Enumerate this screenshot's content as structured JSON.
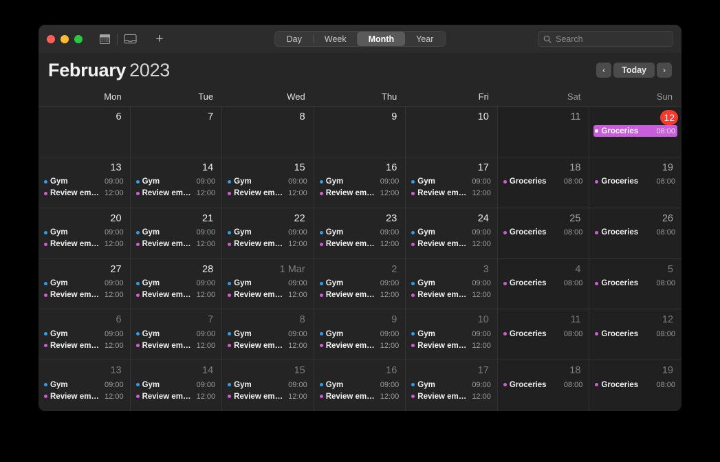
{
  "window": {
    "traffic_lights": [
      {
        "name": "close",
        "color": "#ff5f57"
      },
      {
        "name": "minimize",
        "color": "#febc2e"
      },
      {
        "name": "maximize",
        "color": "#28c840"
      }
    ]
  },
  "toolbar": {
    "calendar_icon": "calendar-icon",
    "inbox_icon": "inbox-icon",
    "add_label": "+",
    "views": [
      {
        "label": "Day",
        "active": false
      },
      {
        "label": "Week",
        "active": false
      },
      {
        "label": "Month",
        "active": true
      },
      {
        "label": "Year",
        "active": false
      }
    ],
    "search": {
      "placeholder": "Search",
      "value": "",
      "icon": "search-icon"
    }
  },
  "header": {
    "month": "February",
    "year": "2023",
    "prev_label": "‹",
    "today_label": "Today",
    "next_label": "›"
  },
  "weekdays": [
    {
      "label": "Mon",
      "weekend": false
    },
    {
      "label": "Tue",
      "weekend": false
    },
    {
      "label": "Wed",
      "weekend": false
    },
    {
      "label": "Thu",
      "weekend": false
    },
    {
      "label": "Fri",
      "weekend": false
    },
    {
      "label": "Sat",
      "weekend": true
    },
    {
      "label": "Sun",
      "weekend": true
    }
  ],
  "colors": {
    "gym": "#2e9fe8",
    "review": "#d35ad8",
    "groceries": "#d35ad8",
    "today_badge": "#f63a2e",
    "selected_event_bg": "#c95ddd"
  },
  "days": [
    {
      "num": "6",
      "dim": false,
      "weekend": false,
      "today": false,
      "events": []
    },
    {
      "num": "7",
      "dim": false,
      "weekend": false,
      "today": false,
      "events": []
    },
    {
      "num": "8",
      "dim": false,
      "weekend": false,
      "today": false,
      "events": []
    },
    {
      "num": "9",
      "dim": false,
      "weekend": false,
      "today": false,
      "events": []
    },
    {
      "num": "10",
      "dim": false,
      "weekend": false,
      "today": false,
      "events": []
    },
    {
      "num": "11",
      "dim": false,
      "weekend": true,
      "today": false,
      "events": []
    },
    {
      "num": "12",
      "dim": false,
      "weekend": true,
      "today": true,
      "events": [
        {
          "title": "Groceries",
          "time": "08:00",
          "color": "#d35ad8",
          "selected": true
        }
      ]
    },
    {
      "num": "13",
      "dim": false,
      "weekend": false,
      "today": false,
      "events": [
        {
          "title": "Gym",
          "time": "09:00",
          "color": "#2e9fe8",
          "selected": false
        },
        {
          "title": "Review emails",
          "time": "12:00",
          "color": "#d35ad8",
          "selected": false
        }
      ]
    },
    {
      "num": "14",
      "dim": false,
      "weekend": false,
      "today": false,
      "events": [
        {
          "title": "Gym",
          "time": "09:00",
          "color": "#2e9fe8",
          "selected": false
        },
        {
          "title": "Review emails",
          "time": "12:00",
          "color": "#d35ad8",
          "selected": false
        }
      ]
    },
    {
      "num": "15",
      "dim": false,
      "weekend": false,
      "today": false,
      "events": [
        {
          "title": "Gym",
          "time": "09:00",
          "color": "#2e9fe8",
          "selected": false
        },
        {
          "title": "Review emails",
          "time": "12:00",
          "color": "#d35ad8",
          "selected": false
        }
      ]
    },
    {
      "num": "16",
      "dim": false,
      "weekend": false,
      "today": false,
      "events": [
        {
          "title": "Gym",
          "time": "09:00",
          "color": "#2e9fe8",
          "selected": false
        },
        {
          "title": "Review emails",
          "time": "12:00",
          "color": "#d35ad8",
          "selected": false
        }
      ]
    },
    {
      "num": "17",
      "dim": false,
      "weekend": false,
      "today": false,
      "events": [
        {
          "title": "Gym",
          "time": "09:00",
          "color": "#2e9fe8",
          "selected": false
        },
        {
          "title": "Review emails",
          "time": "12:00",
          "color": "#d35ad8",
          "selected": false
        }
      ]
    },
    {
      "num": "18",
      "dim": false,
      "weekend": true,
      "today": false,
      "events": [
        {
          "title": "Groceries",
          "time": "08:00",
          "color": "#d35ad8",
          "selected": false
        }
      ]
    },
    {
      "num": "19",
      "dim": false,
      "weekend": true,
      "today": false,
      "events": [
        {
          "title": "Groceries",
          "time": "08:00",
          "color": "#d35ad8",
          "selected": false
        }
      ]
    },
    {
      "num": "20",
      "dim": false,
      "weekend": false,
      "today": false,
      "events": [
        {
          "title": "Gym",
          "time": "09:00",
          "color": "#2e9fe8",
          "selected": false
        },
        {
          "title": "Review emails",
          "time": "12:00",
          "color": "#d35ad8",
          "selected": false
        }
      ]
    },
    {
      "num": "21",
      "dim": false,
      "weekend": false,
      "today": false,
      "events": [
        {
          "title": "Gym",
          "time": "09:00",
          "color": "#2e9fe8",
          "selected": false
        },
        {
          "title": "Review emails",
          "time": "12:00",
          "color": "#d35ad8",
          "selected": false
        }
      ]
    },
    {
      "num": "22",
      "dim": false,
      "weekend": false,
      "today": false,
      "events": [
        {
          "title": "Gym",
          "time": "09:00",
          "color": "#2e9fe8",
          "selected": false
        },
        {
          "title": "Review emails",
          "time": "12:00",
          "color": "#d35ad8",
          "selected": false
        }
      ]
    },
    {
      "num": "23",
      "dim": false,
      "weekend": false,
      "today": false,
      "events": [
        {
          "title": "Gym",
          "time": "09:00",
          "color": "#2e9fe8",
          "selected": false
        },
        {
          "title": "Review emails",
          "time": "12:00",
          "color": "#d35ad8",
          "selected": false
        }
      ]
    },
    {
      "num": "24",
      "dim": false,
      "weekend": false,
      "today": false,
      "events": [
        {
          "title": "Gym",
          "time": "09:00",
          "color": "#2e9fe8",
          "selected": false
        },
        {
          "title": "Review emails",
          "time": "12:00",
          "color": "#d35ad8",
          "selected": false
        }
      ]
    },
    {
      "num": "25",
      "dim": false,
      "weekend": true,
      "today": false,
      "events": [
        {
          "title": "Groceries",
          "time": "08:00",
          "color": "#d35ad8",
          "selected": false
        }
      ]
    },
    {
      "num": "26",
      "dim": false,
      "weekend": true,
      "today": false,
      "events": [
        {
          "title": "Groceries",
          "time": "08:00",
          "color": "#d35ad8",
          "selected": false
        }
      ]
    },
    {
      "num": "27",
      "dim": false,
      "weekend": false,
      "today": false,
      "events": [
        {
          "title": "Gym",
          "time": "09:00",
          "color": "#2e9fe8",
          "selected": false
        },
        {
          "title": "Review emails",
          "time": "12:00",
          "color": "#d35ad8",
          "selected": false
        }
      ]
    },
    {
      "num": "28",
      "dim": false,
      "weekend": false,
      "today": false,
      "events": [
        {
          "title": "Gym",
          "time": "09:00",
          "color": "#2e9fe8",
          "selected": false
        },
        {
          "title": "Review emails",
          "time": "12:00",
          "color": "#d35ad8",
          "selected": false
        }
      ]
    },
    {
      "num": "1 Mar",
      "dim": true,
      "weekend": false,
      "today": false,
      "events": [
        {
          "title": "Gym",
          "time": "09:00",
          "color": "#2e9fe8",
          "selected": false
        },
        {
          "title": "Review emails",
          "time": "12:00",
          "color": "#d35ad8",
          "selected": false
        }
      ]
    },
    {
      "num": "2",
      "dim": true,
      "weekend": false,
      "today": false,
      "events": [
        {
          "title": "Gym",
          "time": "09:00",
          "color": "#2e9fe8",
          "selected": false
        },
        {
          "title": "Review emails",
          "time": "12:00",
          "color": "#d35ad8",
          "selected": false
        }
      ]
    },
    {
      "num": "3",
      "dim": true,
      "weekend": false,
      "today": false,
      "events": [
        {
          "title": "Gym",
          "time": "09:00",
          "color": "#2e9fe8",
          "selected": false
        },
        {
          "title": "Review emails",
          "time": "12:00",
          "color": "#d35ad8",
          "selected": false
        }
      ]
    },
    {
      "num": "4",
      "dim": true,
      "weekend": true,
      "today": false,
      "events": [
        {
          "title": "Groceries",
          "time": "08:00",
          "color": "#d35ad8",
          "selected": false
        }
      ]
    },
    {
      "num": "5",
      "dim": true,
      "weekend": true,
      "today": false,
      "events": [
        {
          "title": "Groceries",
          "time": "08:00",
          "color": "#d35ad8",
          "selected": false
        }
      ]
    },
    {
      "num": "6",
      "dim": true,
      "weekend": false,
      "today": false,
      "events": [
        {
          "title": "Gym",
          "time": "09:00",
          "color": "#2e9fe8",
          "selected": false
        },
        {
          "title": "Review emails",
          "time": "12:00",
          "color": "#d35ad8",
          "selected": false
        }
      ]
    },
    {
      "num": "7",
      "dim": true,
      "weekend": false,
      "today": false,
      "events": [
        {
          "title": "Gym",
          "time": "09:00",
          "color": "#2e9fe8",
          "selected": false
        },
        {
          "title": "Review emails",
          "time": "12:00",
          "color": "#d35ad8",
          "selected": false
        }
      ]
    },
    {
      "num": "8",
      "dim": true,
      "weekend": false,
      "today": false,
      "events": [
        {
          "title": "Gym",
          "time": "09:00",
          "color": "#2e9fe8",
          "selected": false
        },
        {
          "title": "Review emails",
          "time": "12:00",
          "color": "#d35ad8",
          "selected": false
        }
      ]
    },
    {
      "num": "9",
      "dim": true,
      "weekend": false,
      "today": false,
      "events": [
        {
          "title": "Gym",
          "time": "09:00",
          "color": "#2e9fe8",
          "selected": false
        },
        {
          "title": "Review emails",
          "time": "12:00",
          "color": "#d35ad8",
          "selected": false
        }
      ]
    },
    {
      "num": "10",
      "dim": true,
      "weekend": false,
      "today": false,
      "events": [
        {
          "title": "Gym",
          "time": "09:00",
          "color": "#2e9fe8",
          "selected": false
        },
        {
          "title": "Review emails",
          "time": "12:00",
          "color": "#d35ad8",
          "selected": false
        }
      ]
    },
    {
      "num": "11",
      "dim": true,
      "weekend": true,
      "today": false,
      "events": [
        {
          "title": "Groceries",
          "time": "08:00",
          "color": "#d35ad8",
          "selected": false
        }
      ]
    },
    {
      "num": "12",
      "dim": true,
      "weekend": true,
      "today": false,
      "events": [
        {
          "title": "Groceries",
          "time": "08:00",
          "color": "#d35ad8",
          "selected": false
        }
      ]
    },
    {
      "num": "13",
      "dim": true,
      "weekend": false,
      "today": false,
      "events": [
        {
          "title": "Gym",
          "time": "09:00",
          "color": "#2e9fe8",
          "selected": false
        },
        {
          "title": "Review emails",
          "time": "12:00",
          "color": "#d35ad8",
          "selected": false
        }
      ]
    },
    {
      "num": "14",
      "dim": true,
      "weekend": false,
      "today": false,
      "events": [
        {
          "title": "Gym",
          "time": "09:00",
          "color": "#2e9fe8",
          "selected": false
        },
        {
          "title": "Review emails",
          "time": "12:00",
          "color": "#d35ad8",
          "selected": false
        }
      ]
    },
    {
      "num": "15",
      "dim": true,
      "weekend": false,
      "today": false,
      "events": [
        {
          "title": "Gym",
          "time": "09:00",
          "color": "#2e9fe8",
          "selected": false
        },
        {
          "title": "Review emails",
          "time": "12:00",
          "color": "#d35ad8",
          "selected": false
        }
      ]
    },
    {
      "num": "16",
      "dim": true,
      "weekend": false,
      "today": false,
      "events": [
        {
          "title": "Gym",
          "time": "09:00",
          "color": "#2e9fe8",
          "selected": false
        },
        {
          "title": "Review emails",
          "time": "12:00",
          "color": "#d35ad8",
          "selected": false
        }
      ]
    },
    {
      "num": "17",
      "dim": true,
      "weekend": false,
      "today": false,
      "events": [
        {
          "title": "Gym",
          "time": "09:00",
          "color": "#2e9fe8",
          "selected": false
        },
        {
          "title": "Review emails",
          "time": "12:00",
          "color": "#d35ad8",
          "selected": false
        }
      ]
    },
    {
      "num": "18",
      "dim": true,
      "weekend": true,
      "today": false,
      "events": [
        {
          "title": "Groceries",
          "time": "08:00",
          "color": "#d35ad8",
          "selected": false
        }
      ]
    },
    {
      "num": "19",
      "dim": true,
      "weekend": true,
      "today": false,
      "events": [
        {
          "title": "Groceries",
          "time": "08:00",
          "color": "#d35ad8",
          "selected": false
        }
      ]
    }
  ]
}
